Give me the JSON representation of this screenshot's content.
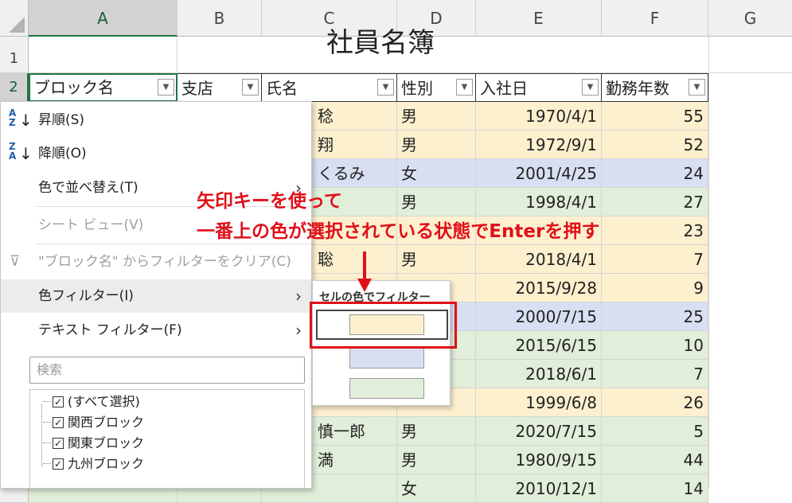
{
  "sheet": {
    "columns": [
      "A",
      "B",
      "C",
      "D",
      "E",
      "F",
      "G"
    ],
    "rows": [
      "1",
      "2"
    ],
    "title": "社員名簿",
    "headers": [
      "ブロック名",
      "支店",
      "氏名",
      "性別",
      "入社日",
      "勤務年数"
    ],
    "data_rows": [
      {
        "name": "稔",
        "gender": "男",
        "date": "1970/4/1",
        "years": "55"
      },
      {
        "name": "翔",
        "gender": "男",
        "date": "1972/9/1",
        "years": "52"
      },
      {
        "name": "くるみ",
        "gender": "女",
        "date": "2001/4/25",
        "years": "24"
      },
      {
        "name": "",
        "gender": "男",
        "date": "1998/4/1",
        "years": "27"
      },
      {
        "name": "",
        "gender": "",
        "date": "",
        "years": "23"
      },
      {
        "name": "聡",
        "gender": "男",
        "date": "2018/4/1",
        "years": "7"
      },
      {
        "name": "",
        "gender": "",
        "date": "2015/9/28",
        "years": "9"
      },
      {
        "name": "",
        "gender": "",
        "date": "2000/7/15",
        "years": "25"
      },
      {
        "name": "",
        "gender": "",
        "date": "2015/6/15",
        "years": "10"
      },
      {
        "name": "",
        "gender": "",
        "date": "2018/6/1",
        "years": "7"
      },
      {
        "name": "",
        "gender": "",
        "date": "1999/6/8",
        "years": "26"
      },
      {
        "name": "慎一郎",
        "gender": "男",
        "date": "2020/7/15",
        "years": "5"
      },
      {
        "name": "満",
        "gender": "男",
        "date": "1980/9/15",
        "years": "44"
      },
      {
        "name": "",
        "gender": "女",
        "date": "2010/12/1",
        "years": "14"
      }
    ],
    "colors": {
      "yellow": "#fdf0cf",
      "blue": "#d9dff2",
      "green": "#e1eed9",
      "grid": "#d4d4d4",
      "accent": "#217346"
    }
  },
  "filter_menu": {
    "sort_asc": "昇順(S)",
    "sort_desc": "降順(O)",
    "sort_by_color": "色で並べ替え(T)",
    "sheet_view": "シート ビュー(V)",
    "clear_filter": "\"ブロック名\" からフィルターをクリア(C)",
    "color_filter": "色フィルター(I)",
    "text_filter": "テキスト フィルター(F)",
    "search_placeholder": "検索",
    "list_items": [
      "(すべて選択)",
      "関西ブロック",
      "関東ブロック",
      "九州ブロック"
    ],
    "icons": {
      "sort_asc": "sort-ascending-icon",
      "sort_desc": "sort-descending-icon",
      "clear": "filter-clear-icon",
      "submenu": "chevron-right-icon"
    }
  },
  "color_submenu": {
    "title": "セルの色でフィルター",
    "swatches": [
      "#fdf0cf",
      "#d9dff2",
      "#e1eed9"
    ]
  },
  "annotation": {
    "line1": "矢印キーを使って",
    "line2": "一番上の色が選択されている状態でEnterを押す",
    "color": "#e0101a"
  }
}
